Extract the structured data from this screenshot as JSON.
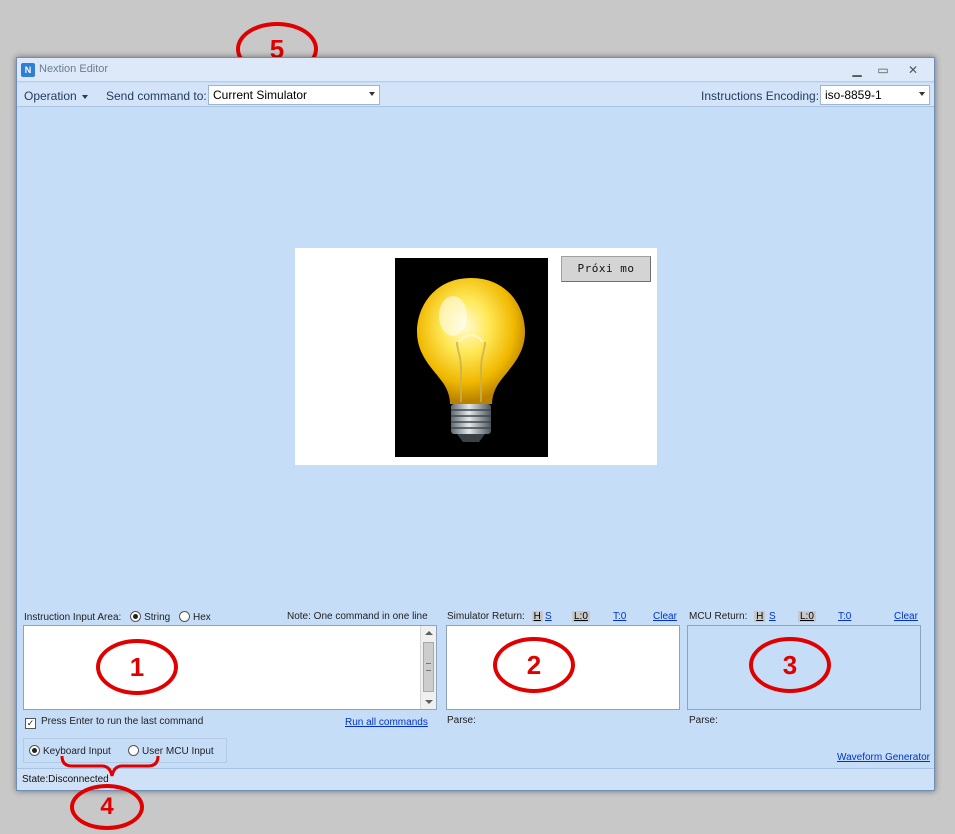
{
  "window": {
    "title": "Nextion Editor",
    "icon_text": "N",
    "minimize": "▁",
    "maximize": "▭",
    "close": "✕"
  },
  "toolbar": {
    "operation_label": "Operation",
    "send_command_label": "Send command to:",
    "send_command_value": "Current Simulator",
    "encoding_label": "Instructions Encoding:",
    "encoding_value": "iso-8859-1"
  },
  "simulator_screen": {
    "next_button_label": "Próxi mo"
  },
  "instruction_area": {
    "label": "Instruction Input Area:",
    "option_string": "String",
    "option_hex": "Hex",
    "selected": "String",
    "note": "Note: One command in one line",
    "enter_checkbox_label": "Press Enter to run the last command",
    "enter_checkbox_checked": true,
    "run_all_link": "Run all commands"
  },
  "simulator_return": {
    "label": "Simulator Return:",
    "h": "H",
    "s": "S",
    "l": "L:0",
    "t": "T:0",
    "clear": "Clear",
    "parse": "Parse:"
  },
  "mcu_return": {
    "label": "MCU Return:",
    "h": "H",
    "s": "S",
    "l": "L:0",
    "t": "T:0",
    "clear": "Clear",
    "parse": "Parse:"
  },
  "input_mode": {
    "keyboard": "Keyboard Input",
    "user_mcu": "User MCU Input",
    "selected": "Keyboard Input"
  },
  "waveform_link": "Waveform Generator",
  "status": "State:Disconnected",
  "annotations": [
    "1",
    "2",
    "3",
    "4",
    "5"
  ],
  "colors": {
    "annotation": "#e00000",
    "window_bg": "#c6ddf7",
    "link": "#0033cc"
  }
}
